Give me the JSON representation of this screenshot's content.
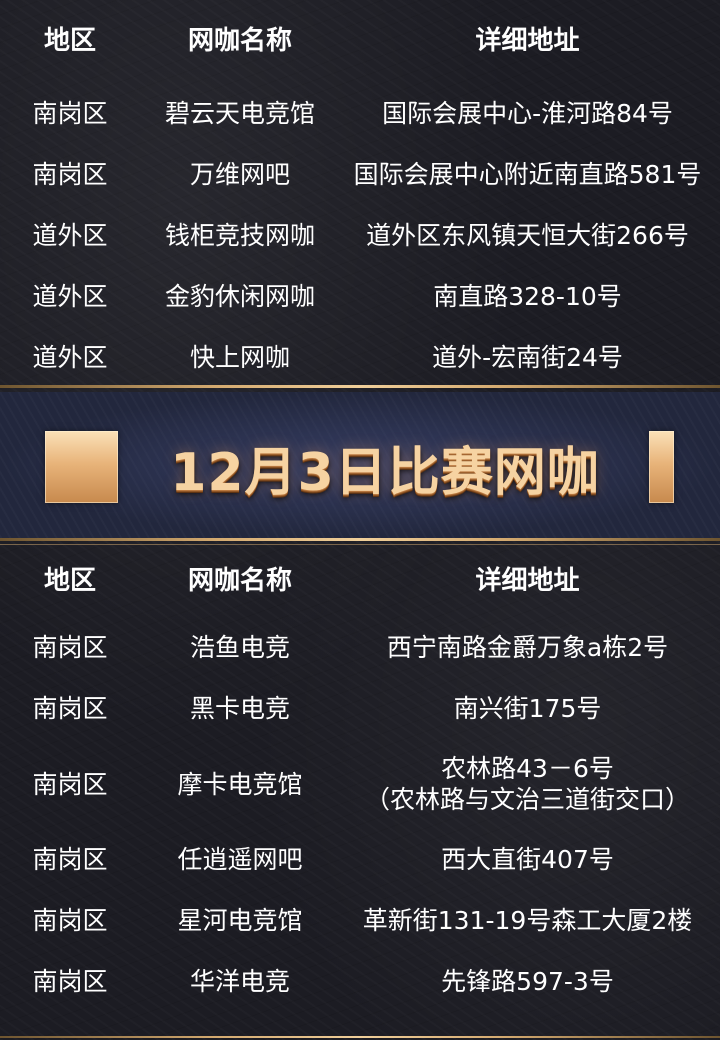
{
  "headers": {
    "region": "地区",
    "name": "网咖名称",
    "address": "详细地址"
  },
  "section1": {
    "rows": [
      {
        "region": "南岗区",
        "name": "碧云天电竞馆",
        "address": [
          "国际会展中心-淮河路84号"
        ]
      },
      {
        "region": "南岗区",
        "name": "万维网吧",
        "address": [
          "国际会展中心附近南直路581号"
        ]
      },
      {
        "region": "道外区",
        "name": "钱柜竞技网咖",
        "address": [
          "道外区东风镇天恒大街266号"
        ]
      },
      {
        "region": "道外区",
        "name": "金豹休闲网咖",
        "address": [
          "南直路328-10号"
        ]
      },
      {
        "region": "道外区",
        "name": "快上网咖",
        "address": [
          "道外-宏南街24号"
        ]
      }
    ]
  },
  "banner": {
    "title": "12月3日比赛网咖",
    "accent_color": "#e8b47a"
  },
  "section2": {
    "rows": [
      {
        "region": "南岗区",
        "name": "浩鱼电竞",
        "address": [
          "西宁南路金爵万象a栋2号"
        ]
      },
      {
        "region": "南岗区",
        "name": "黑卡电竞",
        "address": [
          "南兴街175号"
        ]
      },
      {
        "region": "南岗区",
        "name": "摩卡电竞馆",
        "address": [
          "农林路43－6号",
          "（农林路与文治三道街交口）"
        ]
      },
      {
        "region": "南岗区",
        "name": "任逍遥网吧",
        "address": [
          "西大直街407号"
        ]
      },
      {
        "region": "南岗区",
        "name": "星河电竞馆",
        "address": [
          "革新街131-19号森工大厦2楼"
        ]
      },
      {
        "region": "南岗区",
        "name": "华洋电竞",
        "address": [
          "先锋路597-3号"
        ]
      }
    ]
  }
}
